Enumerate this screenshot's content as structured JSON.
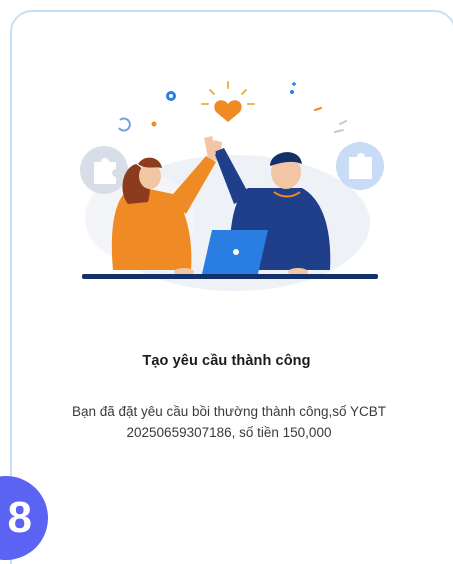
{
  "dialog": {
    "title": "Tạo yêu cầu thành công",
    "message_line1": "Bạn đã đặt yêu cầu bồi thường thành công,số YCBT",
    "message_line2": "20250659307186, số tiền 150,000"
  },
  "step_badge": {
    "number": "8",
    "color": "#5b63f2"
  },
  "colors": {
    "card_border": "#c6e0f7",
    "accent_blue": "#2a7de1",
    "illustration_orange": "#f08a24",
    "illustration_navy": "#14306b"
  },
  "illustration": {
    "icon": "high-five-success-illustration"
  }
}
